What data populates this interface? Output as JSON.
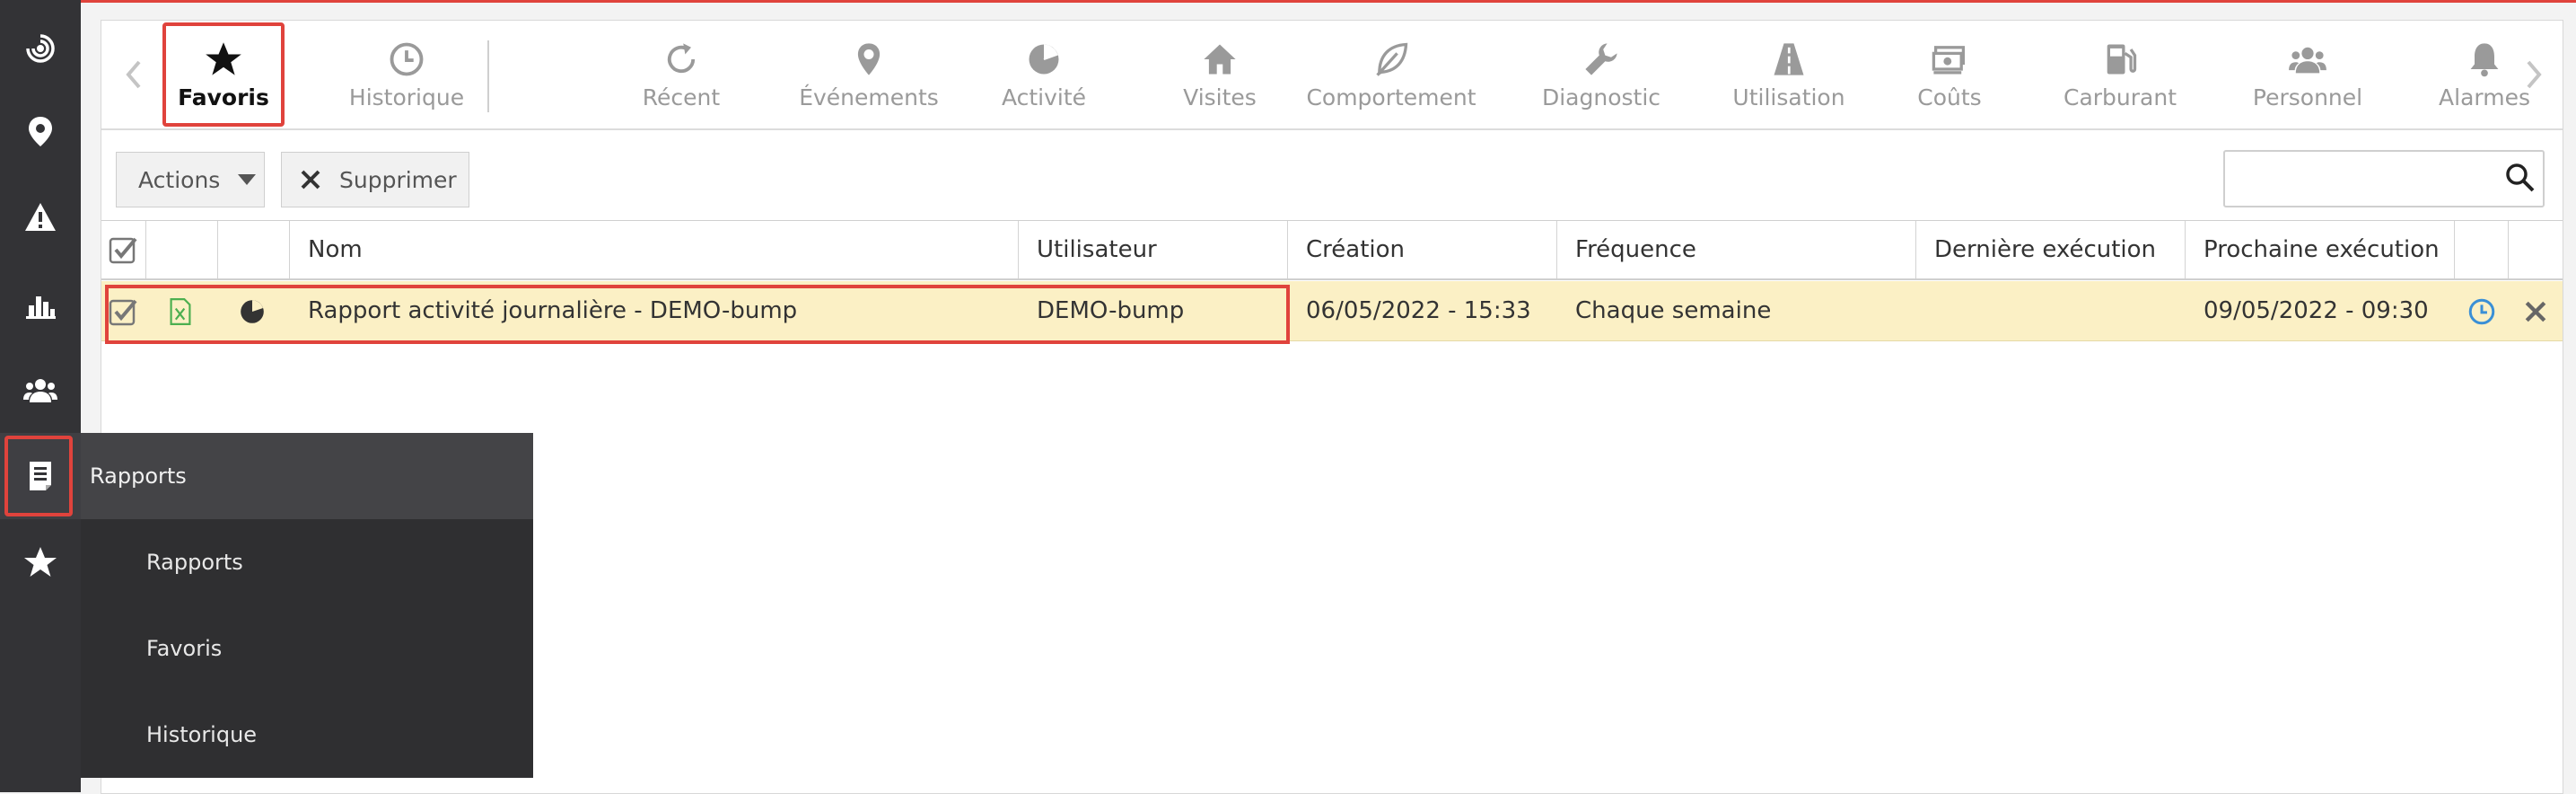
{
  "sidebar": {
    "items": [
      {
        "name": "radar-icon"
      },
      {
        "name": "map-pin-icon"
      },
      {
        "name": "warning-icon"
      },
      {
        "name": "bar-chart-icon"
      },
      {
        "name": "users-icon"
      },
      {
        "name": "report-icon"
      },
      {
        "name": "star-icon"
      }
    ],
    "flyout": {
      "title": "Rapports",
      "items": [
        "Rapports",
        "Favoris",
        "Historique"
      ]
    }
  },
  "tabs": [
    {
      "label": "Favoris",
      "icon": "star-icon"
    },
    {
      "label": "Historique",
      "icon": "clock-icon"
    },
    {
      "label": "Récent",
      "icon": "refresh-icon"
    },
    {
      "label": "Événements",
      "icon": "map-pin-icon"
    },
    {
      "label": "Activité",
      "icon": "pie-icon"
    },
    {
      "label": "Visites",
      "icon": "home-icon"
    },
    {
      "label": "Comportement",
      "icon": "leaf-icon"
    },
    {
      "label": "Diagnostic",
      "icon": "wrench-icon"
    },
    {
      "label": "Utilisation",
      "icon": "road-icon"
    },
    {
      "label": "Coûts",
      "icon": "money-icon"
    },
    {
      "label": "Carburant",
      "icon": "fuel-icon"
    },
    {
      "label": "Personnel",
      "icon": "users-icon"
    },
    {
      "label": "Alarmes",
      "icon": "bell-icon"
    }
  ],
  "actions": {
    "actions_label": "Actions",
    "delete_label": "Supprimer",
    "search_placeholder": ""
  },
  "table": {
    "columns": [
      "Nom",
      "Utilisateur",
      "Création",
      "Fréquence",
      "Dernière exécution",
      "Prochaine exécution"
    ],
    "rows": [
      {
        "nom": "Rapport activité journalière - DEMO-bump",
        "utilisateur": "DEMO-bump",
        "creation": "06/05/2022 - 15:33",
        "frequence": "Chaque semaine",
        "derniere": "",
        "prochaine": "09/05/2022 - 09:30"
      }
    ]
  },
  "colors": {
    "accent_red": "#e0433c",
    "sidebar_bg": "#333336",
    "row_selected": "#fbf0c5",
    "excel_green": "#4caf50",
    "clock_blue": "#3a8fd6"
  }
}
